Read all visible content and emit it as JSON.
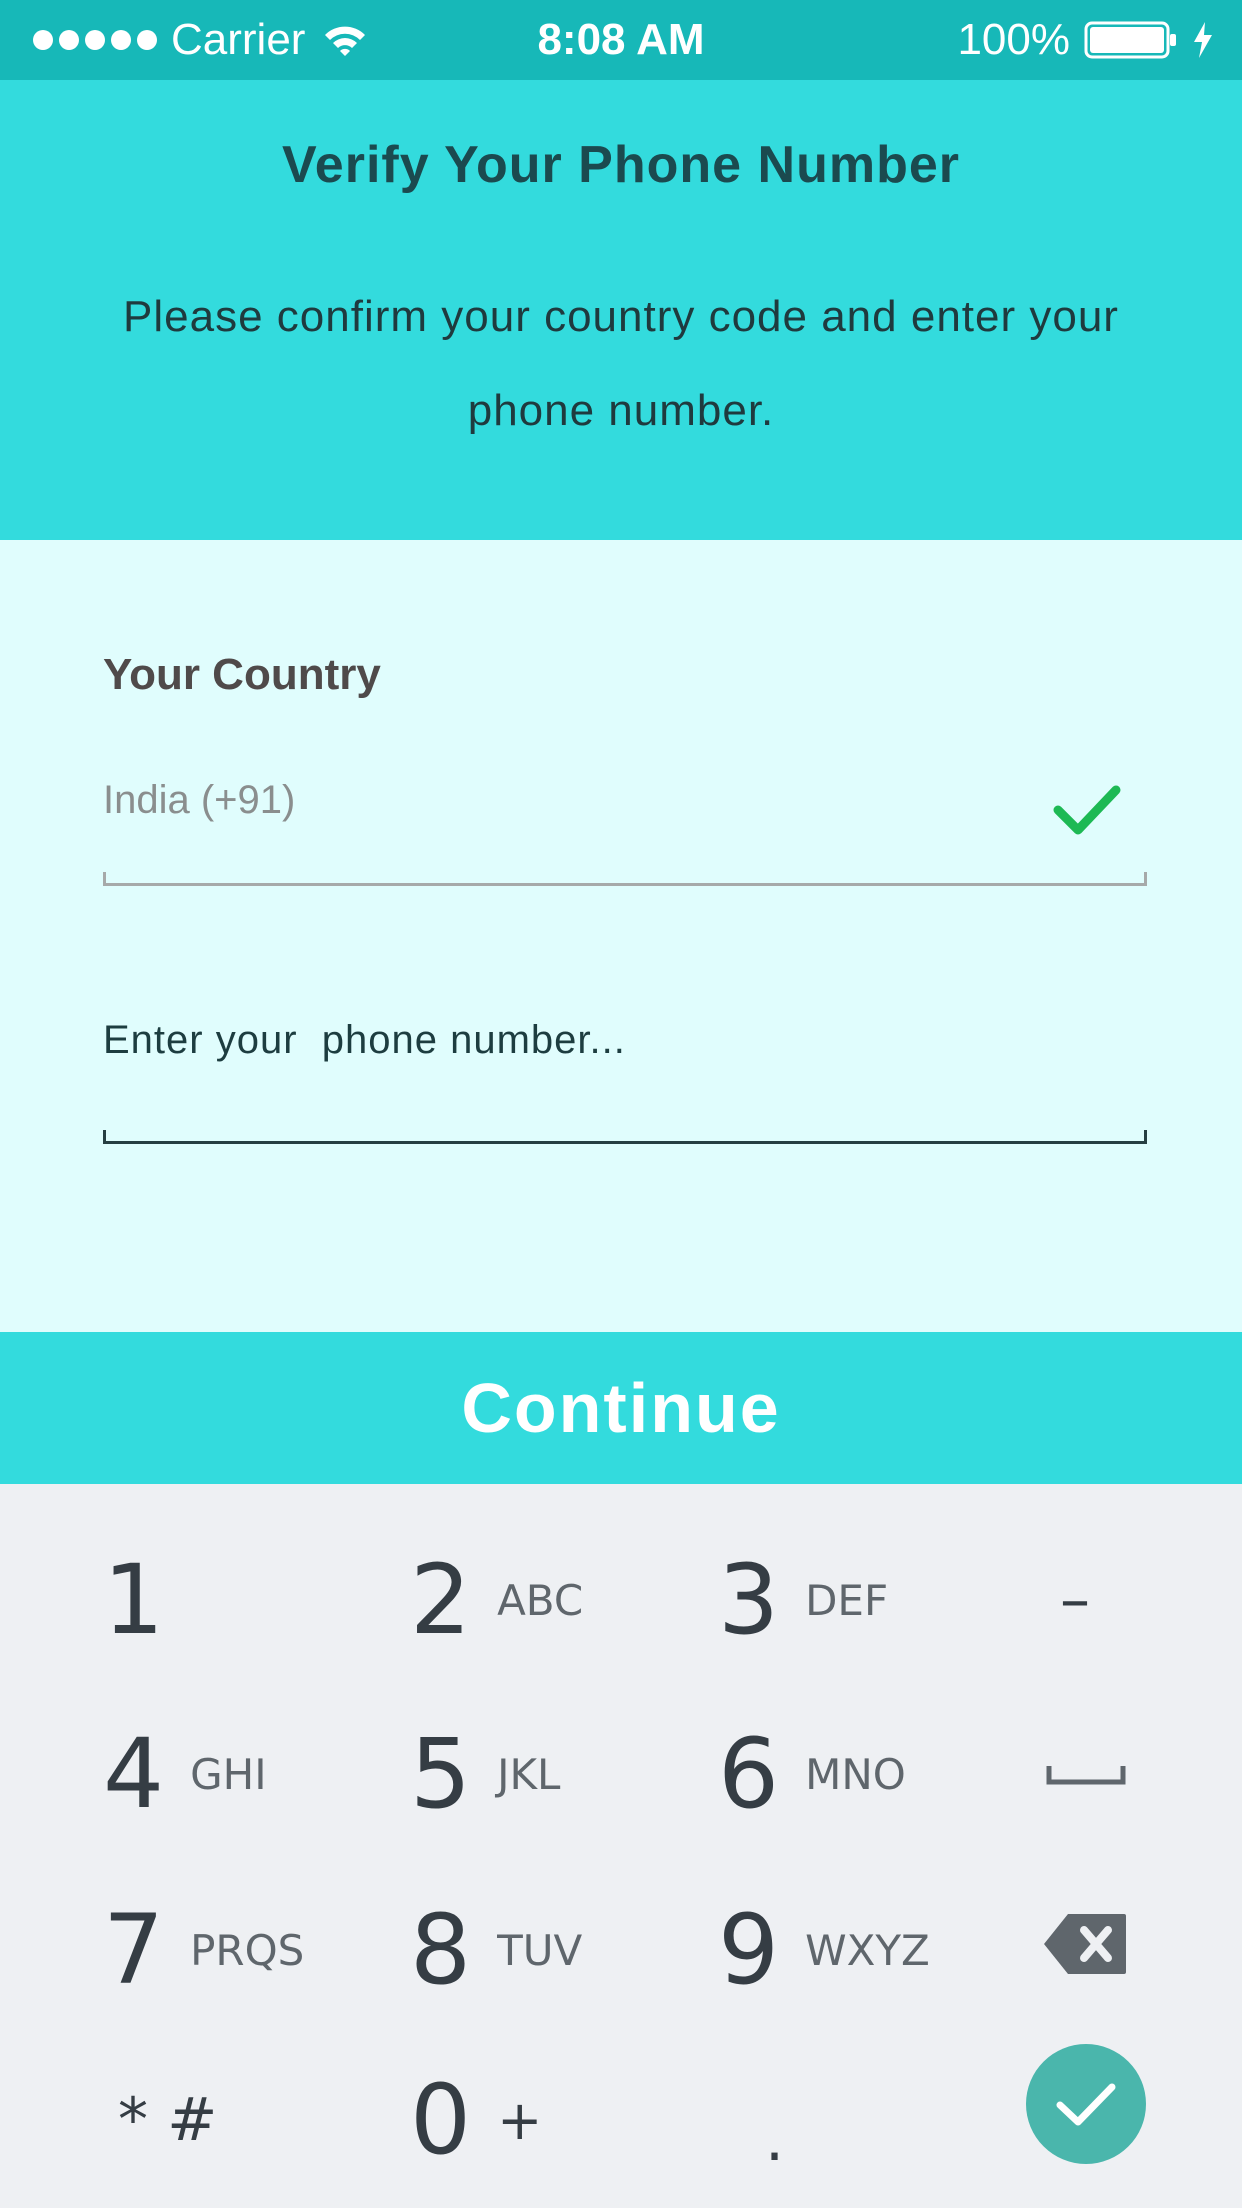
{
  "status_bar": {
    "carrier": "Carrier",
    "time": "8:08 AM",
    "battery": "100%",
    "icons": [
      "signal-dots-icon",
      "wifi-icon",
      "battery-icon",
      "charging-bolt-icon"
    ]
  },
  "header": {
    "title": "Verify Your Phone Number",
    "subtitle": "Please confirm your country code and enter your phone number."
  },
  "form": {
    "country_label": "Your Country",
    "country_value": "India (+91)",
    "country_valid_icon": "checkmark-icon",
    "phone_placeholder": "Enter your  phone number..."
  },
  "continue_label": "Continue",
  "keypad": {
    "keys": [
      {
        "num": "1",
        "letters": ""
      },
      {
        "num": "2",
        "letters": "ABC"
      },
      {
        "num": "3",
        "letters": "DEF"
      },
      {
        "num": "4",
        "letters": "GHI"
      },
      {
        "num": "5",
        "letters": "JKL"
      },
      {
        "num": "6",
        "letters": "MNO"
      },
      {
        "num": "7",
        "letters": "PRQS"
      },
      {
        "num": "8",
        "letters": "TUV"
      },
      {
        "num": "9",
        "letters": "WXYZ"
      },
      {
        "num": "0",
        "letters": "+"
      }
    ],
    "minus": "–",
    "star_hash": "* #",
    "dot": ".",
    "icons": [
      "space-key-icon",
      "backspace-icon",
      "done-check-icon"
    ]
  },
  "colors": {
    "status_bar": "#17b8b8",
    "accent": "#33dbdd",
    "form_bg": "#e0fdfd",
    "keypad_bg": "#eef0f3",
    "check_green": "#1db954",
    "done_button": "#4ab6ac"
  }
}
